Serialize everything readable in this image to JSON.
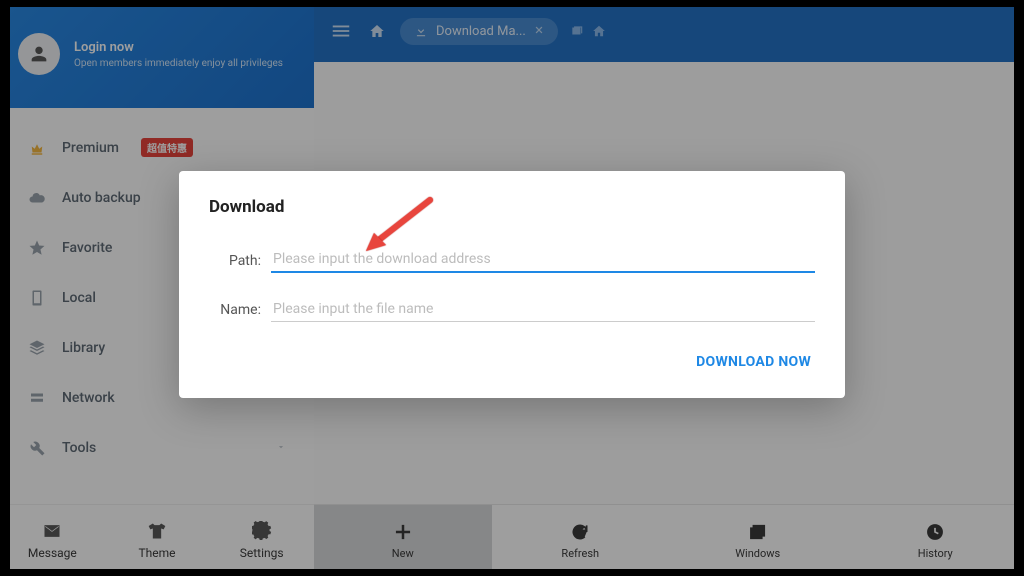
{
  "sidebar": {
    "login": {
      "title": "Login now",
      "subtitle": "Open members immediately enjoy all privileges"
    },
    "items": [
      {
        "label": "Premium",
        "badge": "超值特惠"
      },
      {
        "label": "Auto backup"
      },
      {
        "label": "Favorite"
      },
      {
        "label": "Local"
      },
      {
        "label": "Library"
      },
      {
        "label": "Network"
      },
      {
        "label": "Tools"
      }
    ],
    "footer": {
      "message": "Message",
      "theme": "Theme",
      "settings": "Settings"
    }
  },
  "topbar": {
    "tab_label": "Download Ma..."
  },
  "bottom": {
    "new_": "New",
    "refresh": "Refresh",
    "windows": "Windows",
    "history": "History"
  },
  "dialog": {
    "title": "Download",
    "path_label": "Path:",
    "path_placeholder": "Please input the download address",
    "name_label": "Name:",
    "name_placeholder": "Please input the file name",
    "action": "DOWNLOAD NOW"
  }
}
